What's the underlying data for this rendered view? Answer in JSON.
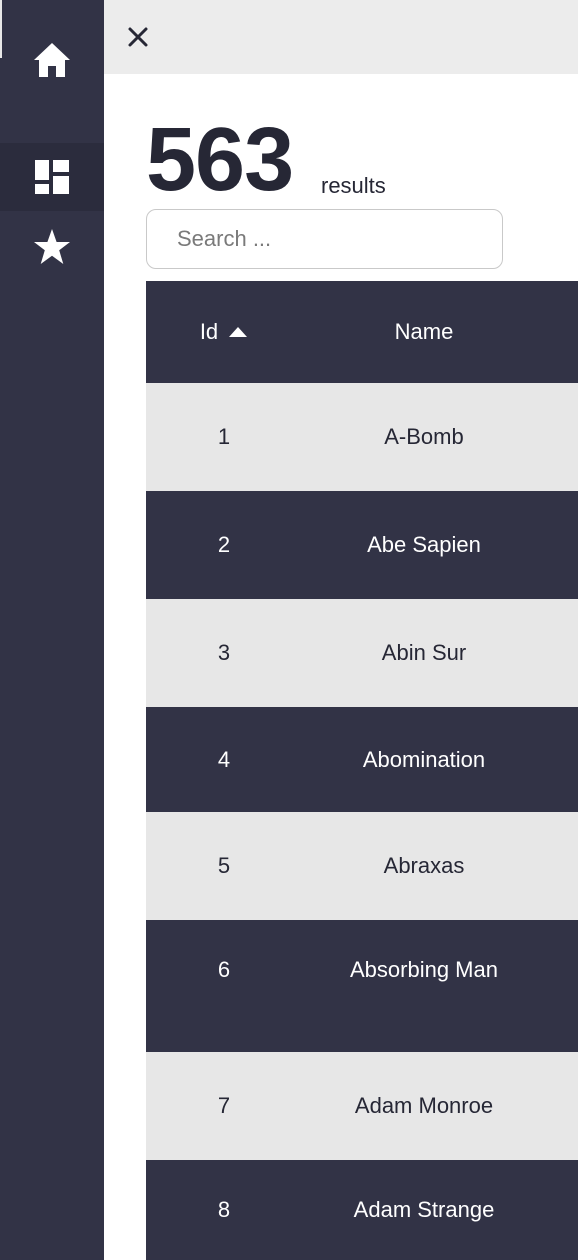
{
  "sidebar": {
    "items": [
      {
        "icon": "home-icon"
      },
      {
        "icon": "dashboard-icon"
      },
      {
        "icon": "star-icon"
      }
    ]
  },
  "topbar": {
    "close_icon": "close-icon"
  },
  "results": {
    "count": "563",
    "label": "results"
  },
  "search": {
    "placeholder": "Search ..."
  },
  "table": {
    "headers": {
      "id": "Id",
      "name": "Name"
    },
    "sort": {
      "column": "Id",
      "direction": "ascending"
    },
    "rows": [
      {
        "id": "1",
        "name": "A-Bomb"
      },
      {
        "id": "2",
        "name": "Abe Sapien"
      },
      {
        "id": "3",
        "name": "Abin Sur"
      },
      {
        "id": "4",
        "name": "Abomination"
      },
      {
        "id": "5",
        "name": "Abraxas"
      },
      {
        "id": "6",
        "name": "Absorbing Man"
      },
      {
        "id": "7",
        "name": "Adam Monroe"
      },
      {
        "id": "8",
        "name": "Adam Strange"
      }
    ]
  },
  "colors": {
    "dark": "#323346",
    "light": "#e7e7e7",
    "topbar": "#ececec"
  }
}
